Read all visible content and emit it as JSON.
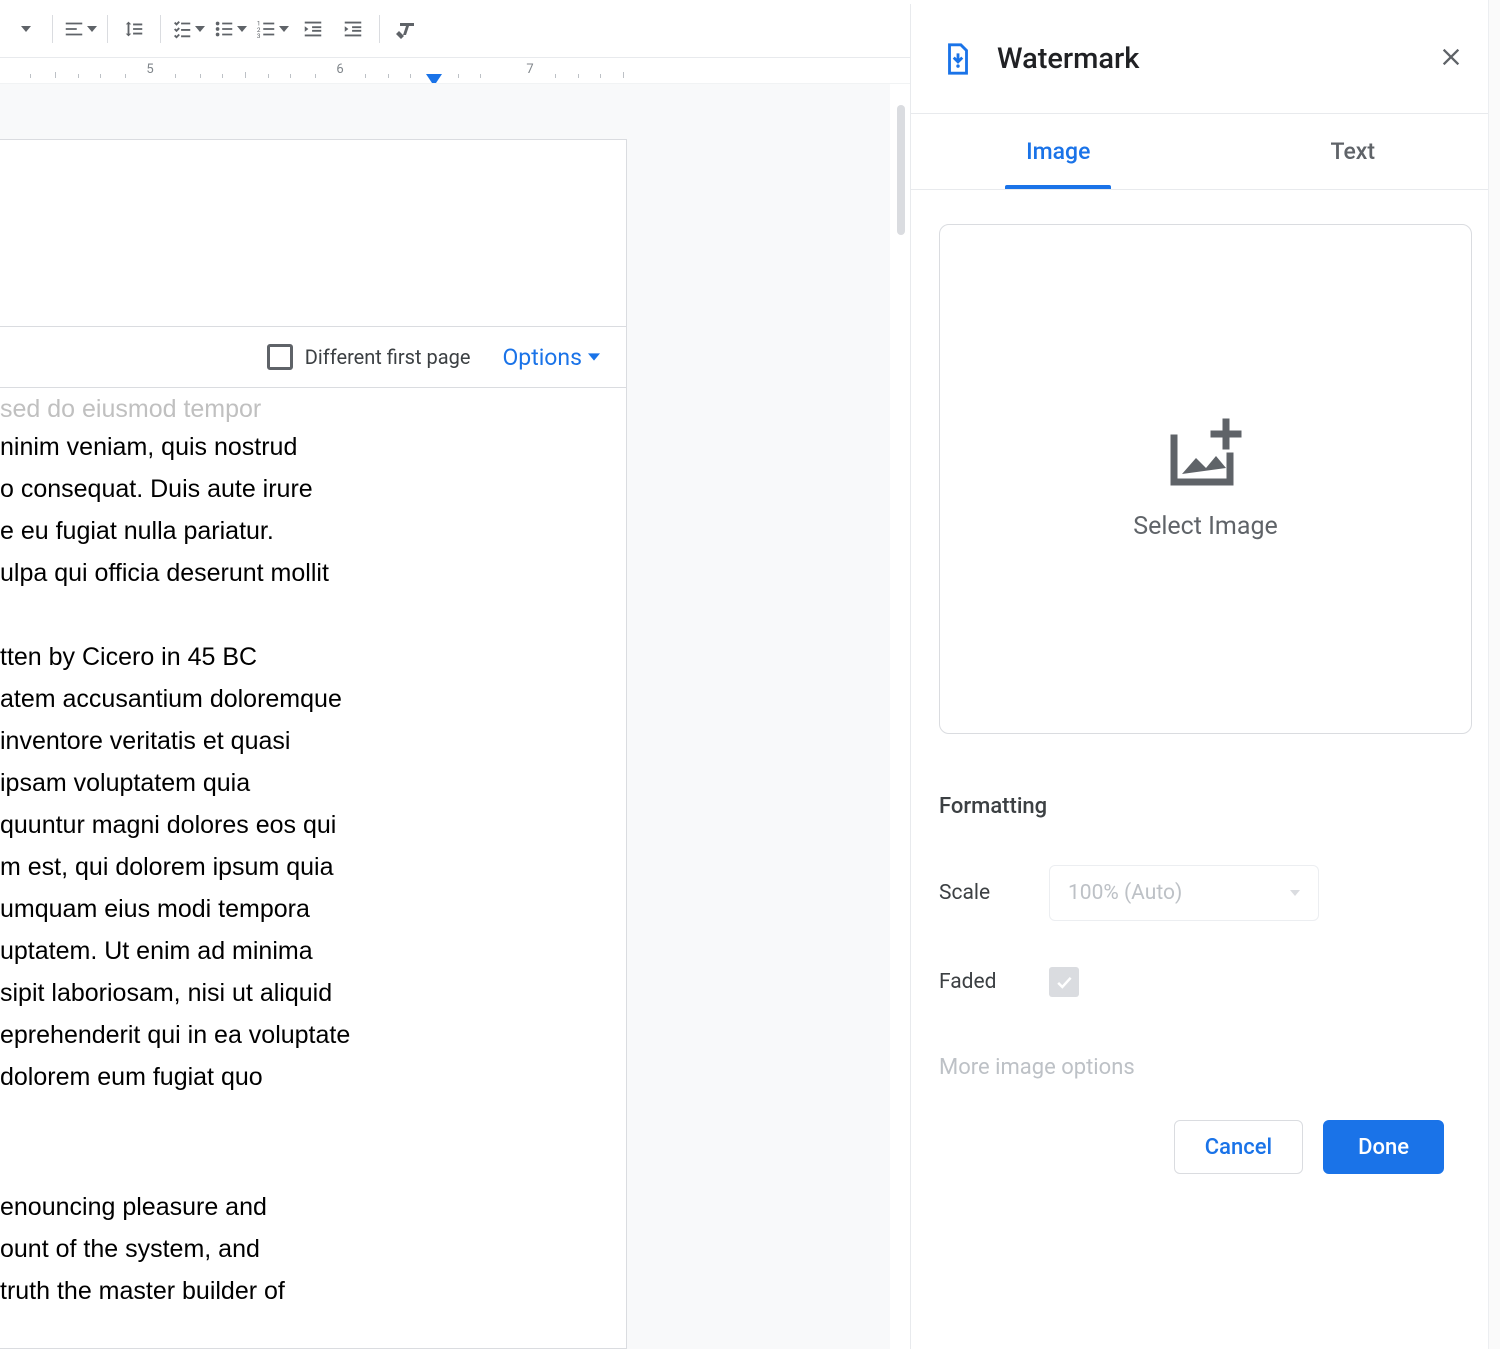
{
  "ruler": {
    "n5": "5",
    "n6": "6",
    "n7": "7"
  },
  "header": {
    "different_first_page": "Different first page",
    "options": "Options"
  },
  "document": {
    "ghost_line": "sed do eiusmod tempor",
    "block1": "ninim veniam, quis nostrud\no consequat. Duis aute irure\ne eu fugiat nulla pariatur.\nulpa qui officia deserunt mollit",
    "block2": "tten by Cicero in 45 BC\natem accusantium doloremque\ninventore veritatis et quasi\nipsam voluptatem quia\nquuntur magni dolores eos qui\nm est, qui dolorem ipsum quia\numquam eius modi tempora\nuptatem. Ut enim ad minima\nsipit laboriosam, nisi ut aliquid\neprehenderit qui in ea voluptate\n dolorem eum fugiat quo",
    "block3": "enouncing pleasure and\nount of the system, and\ntruth  the master builder of"
  },
  "panel": {
    "title": "Watermark",
    "tab_image": "Image",
    "tab_text": "Text",
    "select_image": "Select Image",
    "formatting": "Formatting",
    "scale_label": "Scale",
    "scale_value": "100% (Auto)",
    "faded_label": "Faded",
    "more_options": "More image options",
    "cancel": "Cancel",
    "done": "Done"
  }
}
